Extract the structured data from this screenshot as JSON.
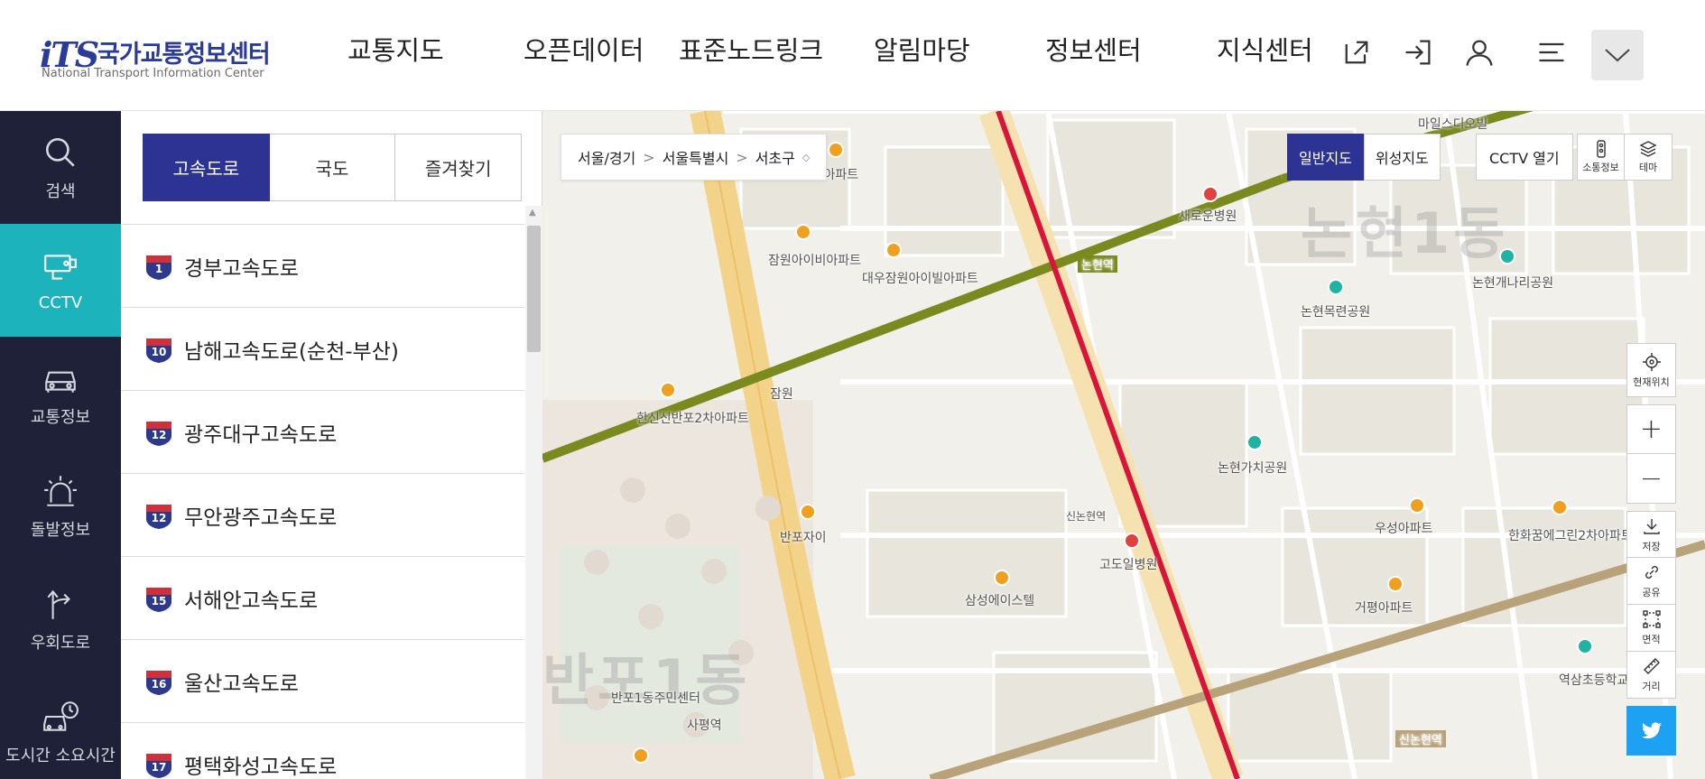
{
  "header": {
    "logo_mark": "iTS",
    "logo_kr": "국가교통정보센터",
    "logo_en": "National Transport Information Center",
    "nav": [
      "교통지도",
      "오픈데이터",
      "표준노드링크",
      "알림마당",
      "정보센터",
      "지식센터"
    ],
    "icons": [
      "external-link-icon",
      "login-icon",
      "user-icon",
      "menu-icon",
      "chevron-down-icon"
    ]
  },
  "sidebar": {
    "items": [
      {
        "label": "검색",
        "icon": "search-icon"
      },
      {
        "label": "CCTV",
        "icon": "cctv-icon",
        "active": true
      },
      {
        "label": "교통정보",
        "icon": "car-icon"
      },
      {
        "label": "돌발정보",
        "icon": "alert-siren-icon"
      },
      {
        "label": "우회도로",
        "icon": "detour-icon"
      },
      {
        "label": "도시간 소요시간",
        "icon": "car-clock-icon"
      }
    ]
  },
  "panel": {
    "tabs": [
      {
        "label": "고속도로",
        "active": true
      },
      {
        "label": "국도",
        "active": false
      },
      {
        "label": "즐겨찾기",
        "active": false
      }
    ],
    "roads": [
      {
        "num": "1",
        "name": "경부고속도로"
      },
      {
        "num": "10",
        "name": "남해고속도로(순천-부산)"
      },
      {
        "num": "12",
        "name": "광주대구고속도로"
      },
      {
        "num": "12",
        "name": "무안광주고속도로"
      },
      {
        "num": "15",
        "name": "서해안고속도로"
      },
      {
        "num": "16",
        "name": "울산고속도로"
      },
      {
        "num": "17",
        "name": "평택화성고속도로"
      }
    ]
  },
  "map": {
    "breadcrumb": [
      "서울/경기",
      "서울특별시",
      "서초구"
    ],
    "map_types": [
      {
        "label": "일반지도",
        "active": true
      },
      {
        "label": "위성지도",
        "active": false
      }
    ],
    "cctv_open": "CCTV 열기",
    "top_tools": [
      {
        "label": "소통정보",
        "icon": "traffic-light-icon"
      },
      {
        "label": "테마",
        "icon": "layers-icon"
      }
    ],
    "right_tools": {
      "locate": "현재위치",
      "zoom_in": "+",
      "zoom_out": "−",
      "save": "저장",
      "share": "공유",
      "area": "면적",
      "distance": "거리"
    },
    "dong_labels": [
      "논현1동",
      "반포1동"
    ],
    "labels": [
      "논현역",
      "신논현역",
      "잠원",
      "새로운병원",
      "논현목련공원",
      "논현개나리공원",
      "논현가치공원",
      "한신신반포2차아파트",
      "잠원아이비아파트",
      "대우잠원아이빌아파트",
      "반포자이",
      "삼성에이스텔",
      "고도일병원",
      "우성아파트",
      "거평아파트",
      "한화꿈에그린2차아파트",
      "반포1동주민센터",
      "사평역",
      "신논현역",
      "마일스디오빌",
      "주마오렉아파트",
      "역삼초등학교"
    ],
    "colors": {
      "line7": "#7a8a1f",
      "line9": "#b8a27a",
      "sinbundang": "#d8143a",
      "expressway": "#f3d38a"
    }
  }
}
